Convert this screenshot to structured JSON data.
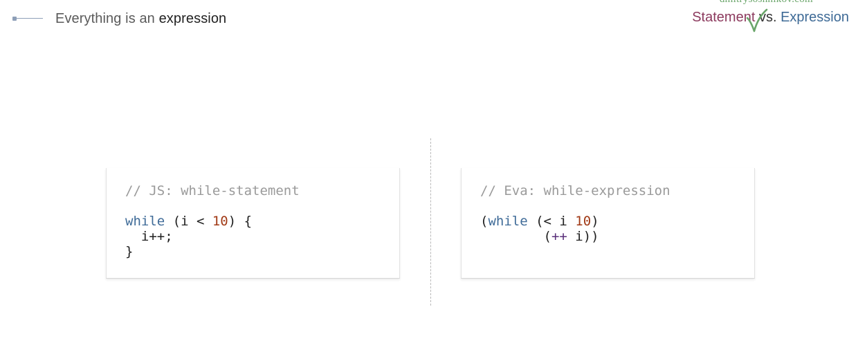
{
  "header": {
    "title_prefix": "Everything is an ",
    "title_bold": "expression"
  },
  "topic": {
    "watermark": "dmitrysoshnikov.com",
    "statement": "Statement",
    "vs": " vs. ",
    "expression": "Expression"
  },
  "icons": {
    "bullet": "bullet-line-icon",
    "check": "checkmark-icon"
  },
  "colors": {
    "statement": "#8c3a5e",
    "expression": "#3e6a96",
    "keyword": "#3f6b98",
    "number": "#a13a16",
    "comment": "#9a9a9a",
    "check": "#6aa56a"
  },
  "left_card": {
    "comment": "// JS: while-statement",
    "kw": "while",
    "l1_a": " (i < ",
    "num": "10",
    "l1_b": ") {",
    "l2": "  i++;",
    "l3": "}"
  },
  "right_card": {
    "comment": "// Eva: while-expression",
    "paren": "(",
    "kw": "while",
    "l1_a": " (< i ",
    "num": "10",
    "l1_b": ")",
    "l2_indent": "        (",
    "op": "++",
    "l2_b": " i))"
  }
}
